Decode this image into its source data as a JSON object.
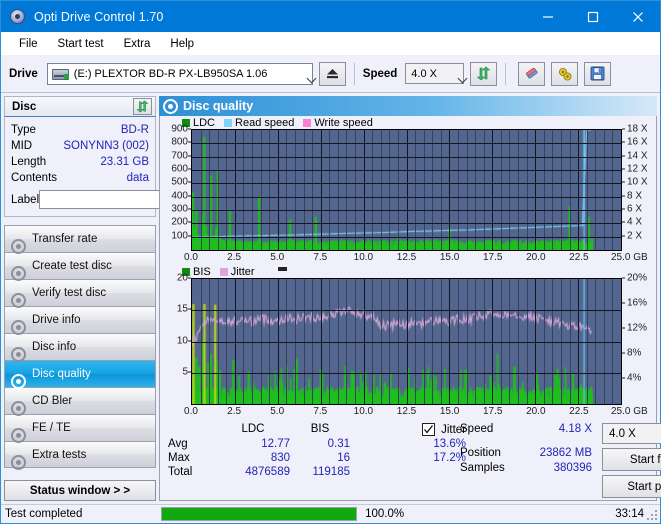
{
  "window": {
    "title": "Opti Drive Control 1.70",
    "app_icon": "disc-icon",
    "minimize": "–",
    "maximize": "□",
    "close": "✕"
  },
  "menu": {
    "items": [
      {
        "label": "File"
      },
      {
        "label": "Start test"
      },
      {
        "label": "Extra"
      },
      {
        "label": "Help"
      }
    ]
  },
  "toolbar": {
    "drive_label": "Drive",
    "drive_value": "(E:)   PLEXTOR BD-R  PX-LB950SA 1.06",
    "eject_icon": "eject-icon",
    "speed_label": "Speed",
    "speed_value": "4.0 X",
    "refresh_icon": "refresh-icon",
    "erase_icon": "eraser-icon",
    "settings_icon": "gears-icon",
    "save_icon": "floppy-save-icon"
  },
  "disc_panel": {
    "header": "Disc",
    "refresh_icon": "refresh-icon",
    "rows": [
      {
        "key": "Type",
        "value": "BD-R"
      },
      {
        "key": "MID",
        "value": "SONYNN3 (002)"
      },
      {
        "key": "Length",
        "value": "23.31 GB"
      },
      {
        "key": "Contents",
        "value": "data"
      }
    ],
    "label_key": "Label",
    "label_value": "",
    "label_placeholder": "",
    "label_btn_icon": "disc-icon"
  },
  "sidebar": {
    "items": [
      {
        "label": "Transfer rate",
        "icon": "disc-test-icon",
        "active": false
      },
      {
        "label": "Create test disc",
        "icon": "disc-burn-icon",
        "active": false
      },
      {
        "label": "Verify test disc",
        "icon": "disc-verify-icon",
        "active": false
      },
      {
        "label": "Drive info",
        "icon": "disc-drive-icon",
        "active": false
      },
      {
        "label": "Disc info",
        "icon": "disc-info-icon",
        "active": false
      },
      {
        "label": "Disc quality",
        "icon": "disc-quality-icon",
        "active": true
      },
      {
        "label": "CD Bler",
        "icon": "disc-bler-icon",
        "active": false
      },
      {
        "label": "FE / TE",
        "icon": "disc-fete-icon",
        "active": false
      },
      {
        "label": "Extra tests",
        "icon": "disc-extra-icon",
        "active": false
      }
    ],
    "status_button": "Status window > >"
  },
  "main": {
    "header": "Disc quality",
    "header_icon": "disc-quality-icon"
  },
  "stats": {
    "col_headers": [
      "LDC",
      "BIS"
    ],
    "jitter_label": "Jitter",
    "jitter_checked": true,
    "rows": [
      {
        "label": "Avg",
        "ldc": "12.77",
        "bis": "0.31",
        "jitter": "13.6%"
      },
      {
        "label": "Max",
        "ldc": "830",
        "bis": "16",
        "jitter": "17.2%"
      },
      {
        "label": "Total",
        "ldc": "4876589",
        "bis": "119185",
        "jitter": ""
      }
    ],
    "speed_label": "Speed",
    "speed_value": "4.18 X",
    "position_label": "Position",
    "position_value": "23862 MB",
    "samples_label": "Samples",
    "samples_value": "380396",
    "speed_select": "4.0 X",
    "start_full": "Start full",
    "start_part": "Start part"
  },
  "statusbar": {
    "text": "Test completed",
    "progress_pct": 100.0,
    "progress_label": "100.0%",
    "elapsed": "33:14"
  },
  "colors": {
    "accent": "#0078d7",
    "plot_bg": "#53668f",
    "ldc": "#1fbf1f",
    "bis": "#1fbf1f",
    "read_speed": "#7fd4f5",
    "write_speed": "#f77fd4",
    "jitter": "#d9a8d9",
    "progress": "#12a812",
    "value_text": "#2323b8"
  },
  "chart_data": [
    {
      "type": "bar",
      "id": "ldc-chart",
      "title": "",
      "xlabel": "GB",
      "ylabel": "LDC",
      "grid": true,
      "legend": [
        {
          "label": "LDC",
          "color": "#1fbf1f"
        },
        {
          "label": "Read speed",
          "color": "#7fd4f5"
        },
        {
          "label": "Write speed",
          "color": "#f77fd4"
        }
      ],
      "xlim": [
        0,
        25
      ],
      "xticks": [
        "0.0",
        "2.5",
        "5.0",
        "7.5",
        "10.0",
        "12.5",
        "15.0",
        "17.5",
        "20.0",
        "22.5",
        "25.0"
      ],
      "xunit": "GB",
      "ylim": [
        0,
        900
      ],
      "yticks": [
        100,
        200,
        300,
        400,
        500,
        600,
        700,
        800,
        900
      ],
      "y2lim": [
        0,
        18
      ],
      "y2ticks": [
        "2 X",
        "4 X",
        "6 X",
        "8 X",
        "10 X",
        "12 X",
        "14 X",
        "16 X",
        "18 X"
      ],
      "data_end_x": 23.31,
      "series": [
        {
          "name": "LDC",
          "type": "bar",
          "color": "#1fbf1f",
          "baseline": 60,
          "x": [
            0.05,
            0.15,
            0.25,
            0.3,
            0.4,
            0.5,
            0.6,
            0.7,
            0.8,
            0.9,
            1.0,
            1.1,
            1.2,
            1.3,
            1.4,
            1.5,
            1.6,
            1.7,
            1.8,
            1.9,
            2.0,
            2.2,
            2.4,
            2.6,
            2.8,
            3.0,
            3.3,
            3.6,
            3.9,
            4.2,
            4.5,
            4.8,
            5.1,
            5.4,
            5.7,
            6.0,
            6.4,
            6.8,
            7.2,
            7.6,
            8.0,
            8.5,
            9.0,
            9.5,
            10.0,
            10.5,
            11.0,
            11.5,
            12.0,
            12.5,
            13.0,
            13.5,
            14.0,
            14.5,
            15.0,
            15.5,
            16.0,
            16.5,
            17.0,
            17.5,
            18.0,
            18.5,
            19.0,
            19.5,
            20.0,
            20.5,
            21.0,
            21.5,
            22.0,
            22.4,
            22.8,
            23.1,
            23.3
          ],
          "values": [
            430,
            170,
            300,
            120,
            95,
            90,
            260,
            850,
            180,
            110,
            90,
            560,
            90,
            85,
            170,
            600,
            95,
            80,
            75,
            70,
            90,
            300,
            70,
            65,
            70,
            60,
            65,
            60,
            400,
            60,
            62,
            60,
            64,
            60,
            230,
            62,
            60,
            60,
            250,
            60,
            62,
            65,
            60,
            60,
            70,
            60,
            60,
            62,
            100,
            60,
            60,
            62,
            60,
            60,
            160,
            60,
            62,
            60,
            60,
            60,
            60,
            60,
            70,
            60,
            65,
            60,
            60,
            80,
            330,
            60,
            70,
            250,
            90
          ]
        },
        {
          "name": "Read speed",
          "type": "line",
          "color": "#7fd4f5",
          "x": [
            0.0,
            1.0,
            2.0,
            3.0,
            4.0,
            5.0,
            6.0,
            7.0,
            8.0,
            9.0,
            10.0,
            11.0,
            12.0,
            13.0,
            14.0,
            15.0,
            16.0,
            17.0,
            18.0,
            19.0,
            20.0,
            21.0,
            22.0,
            22.9,
            23.0,
            23.1
          ],
          "values": [
            1.9,
            1.95,
            2.05,
            2.1,
            2.15,
            2.2,
            2.25,
            2.35,
            2.4,
            2.5,
            2.55,
            2.6,
            2.7,
            2.8,
            2.85,
            2.95,
            3.0,
            3.1,
            3.2,
            3.3,
            3.4,
            3.5,
            3.6,
            3.65,
            18.0,
            18.0
          ]
        }
      ],
      "marker_line": {
        "x": 22.85,
        "color": "#66ccf2"
      }
    },
    {
      "type": "bar",
      "id": "bis-jitter-chart",
      "title": "",
      "xlabel": "GB",
      "ylabel": "BIS",
      "grid": true,
      "legend": [
        {
          "label": "BIS",
          "color": "#1fbf1f"
        },
        {
          "label": "Jitter",
          "color": "#d9a8d9"
        }
      ],
      "xlim": [
        0,
        25
      ],
      "xticks": [
        "0.0",
        "2.5",
        "5.0",
        "7.5",
        "10.0",
        "12.5",
        "15.0",
        "17.5",
        "20.0",
        "22.5",
        "25.0"
      ],
      "xunit": "GB",
      "ylim": [
        0,
        20
      ],
      "yticks": [
        5,
        10,
        15,
        20
      ],
      "y2lim": [
        0,
        20
      ],
      "y2ticks": [
        "4%",
        "8%",
        "12%",
        "16%",
        "20%"
      ],
      "data_end_x": 23.31,
      "series": [
        {
          "name": "BIS",
          "type": "bar",
          "color": "#1fbf1f",
          "baseline": 2.0,
          "avg": 0.31,
          "max": 16
        },
        {
          "name": "Jitter",
          "type": "line",
          "color": "#d9a8d9",
          "avg_pct": 13.6,
          "max_pct": 17.2,
          "x": [
            0.0,
            0.3,
            0.6,
            0.9,
            1.2,
            1.6,
            2.0,
            2.5,
            3.0,
            3.5,
            4.0,
            4.5,
            5.0,
            5.5,
            6.0,
            6.5,
            7.0,
            7.5,
            8.0,
            8.5,
            9.0,
            9.5,
            10.0,
            10.5,
            11.0,
            11.5,
            12.0,
            12.5,
            13.0,
            13.5,
            14.0,
            14.5,
            15.0,
            15.5,
            16.0,
            16.5,
            17.0,
            17.5,
            18.0,
            18.5,
            19.0,
            19.5,
            20.0,
            20.5,
            21.0,
            21.5,
            22.0,
            22.5,
            22.9,
            23.1
          ],
          "values": [
            9.8,
            11.0,
            12.5,
            13.6,
            12.9,
            13.4,
            13.0,
            13.3,
            13.4,
            13.2,
            13.6,
            13.5,
            13.4,
            13.8,
            13.5,
            13.9,
            13.9,
            14.0,
            14.2,
            14.6,
            15.0,
            14.6,
            14.3,
            14.0,
            12.7,
            12.5,
            12.9,
            12.6,
            13.1,
            12.9,
            13.2,
            13.5,
            13.1,
            13.6,
            13.4,
            13.8,
            14.1,
            14.5,
            14.2,
            14.6,
            14.3,
            14.0,
            13.9,
            13.5,
            13.2,
            12.8,
            12.6,
            12.4,
            12.3,
            11.9
          ]
        }
      ],
      "marker_line": {
        "x": 22.85,
        "color": "#66ccf2"
      }
    }
  ]
}
